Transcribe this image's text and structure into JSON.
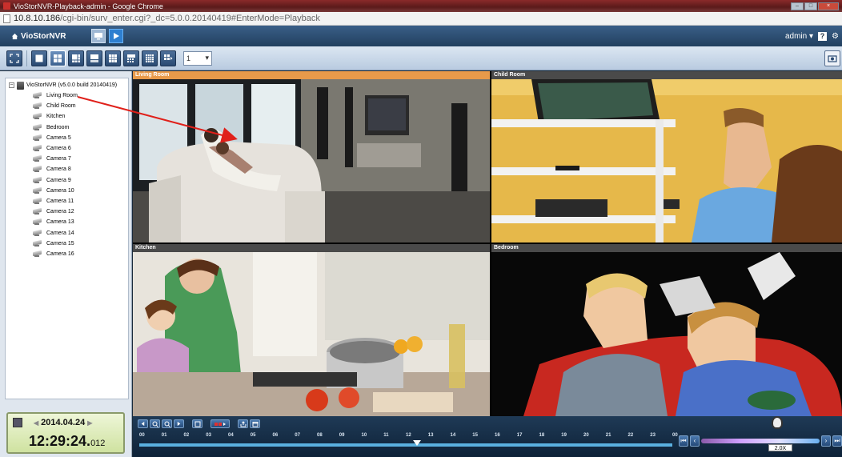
{
  "browser": {
    "title": "VioStorNVR-Playback-admin - Google Chrome",
    "url_main": "10.8.10.186",
    "url_rest": "/cgi-bin/surv_enter.cgi?_dc=5.0.0.20140419#EnterMode=Playback"
  },
  "app": {
    "logo": "VioStorNVR",
    "user": "admin",
    "help": "?",
    "channel_select": "1"
  },
  "tree": {
    "root": "VioStorNVR (v5.0.0 build 20140419)",
    "cameras": [
      "Living Room",
      "Child Room",
      "Kitchen",
      "Bedroom",
      "Camera 5",
      "Camera 6",
      "Camera 7",
      "Camera 8",
      "Camera 9",
      "Camera 10",
      "Camera 11",
      "Camera 12",
      "Camera 13",
      "Camera 14",
      "Camera 15",
      "Camera 16"
    ]
  },
  "clock": {
    "date": "2014.04.24",
    "time": "12:29:24.",
    "ms": "012"
  },
  "panes": [
    {
      "title": "Living Room",
      "active": true
    },
    {
      "title": "Child Room",
      "active": false
    },
    {
      "title": "Kitchen",
      "active": false
    },
    {
      "title": "Bedroom",
      "active": false
    }
  ],
  "timeline": {
    "hours": [
      "00",
      "01",
      "02",
      "03",
      "04",
      "05",
      "06",
      "07",
      "08",
      "09",
      "10",
      "11",
      "12",
      "13",
      "14",
      "15",
      "16",
      "17",
      "18",
      "19",
      "20",
      "21",
      "22",
      "23",
      "00"
    ],
    "cursor_hour": 12.49,
    "speed": "2.0X"
  },
  "colors": {
    "active_header": "#e89a4a",
    "annotation_arrow": "#e0201a"
  }
}
